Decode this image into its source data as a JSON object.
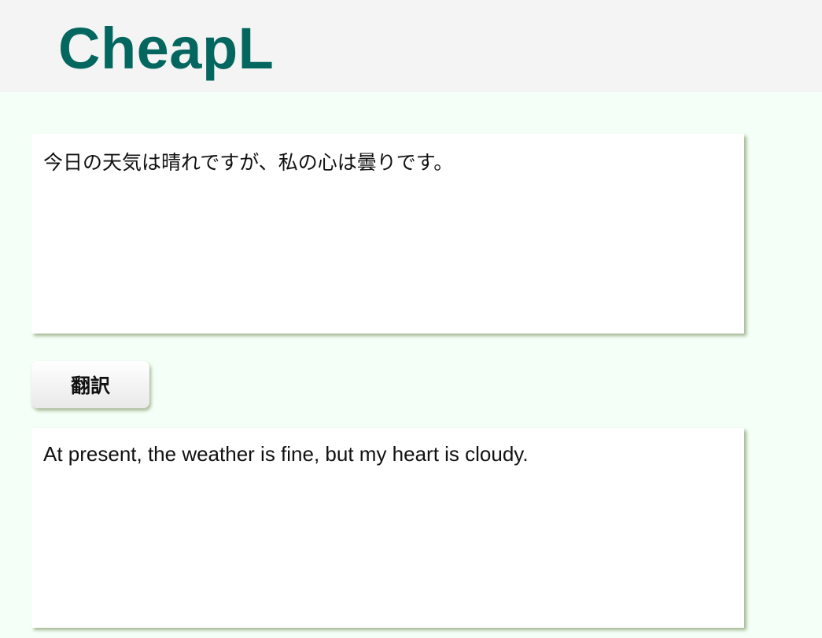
{
  "header": {
    "logo_text": "CheapL"
  },
  "translator": {
    "source_text": "今日の天気は晴れですが、私の心は曇りです。",
    "translate_button_label": "翻訳",
    "result_text": "At present, the weather is fine, but my heart is cloudy."
  },
  "colors": {
    "brand": "#04675f",
    "page_background": "#f4fff7",
    "header_background": "#f4f4f4"
  }
}
